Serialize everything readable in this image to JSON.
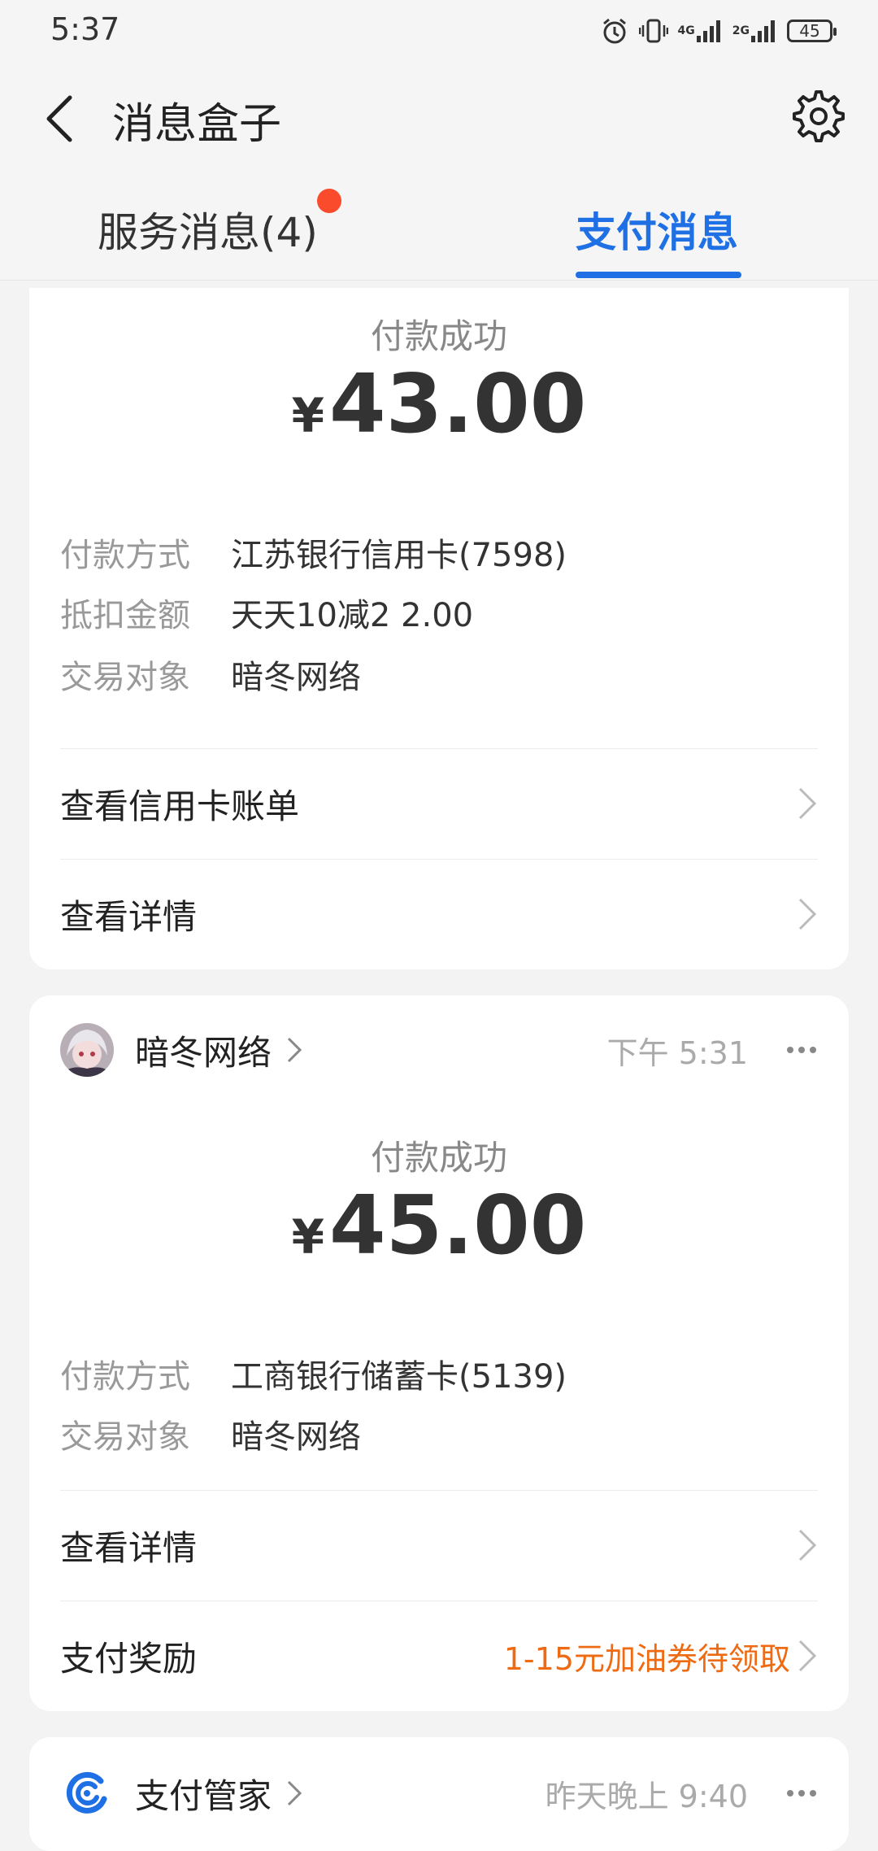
{
  "status_bar": {
    "time": "5:37",
    "network1": "4G",
    "network2": "2G",
    "battery": "45",
    "icons": [
      "alarm-icon",
      "vibrate-icon",
      "signal-icon",
      "signal-icon",
      "battery-icon"
    ]
  },
  "header": {
    "title": "消息盒子",
    "back_icon": "chevron-left-icon",
    "settings_icon": "gear-icon"
  },
  "tabs": [
    {
      "label": "服务消息(4)",
      "active": false,
      "has_dot": true
    },
    {
      "label": "支付消息",
      "active": true
    }
  ],
  "colors": {
    "accent": "#1f6fe5",
    "dot": "#fa4b2d",
    "promo": "#ee6a13"
  },
  "cards": [
    {
      "status": "付款成功",
      "currency": "¥",
      "amount": "43.00",
      "fields": [
        {
          "key": "付款方式",
          "value": "江苏银行信用卡(7598)"
        },
        {
          "key": "抵扣金额",
          "value": "天天10减2 2.00"
        },
        {
          "key": "交易对象",
          "value": "暗冬网络"
        }
      ],
      "actions": [
        {
          "label": "查看信用卡账单"
        },
        {
          "label": "查看详情"
        }
      ]
    },
    {
      "merchant": "暗冬网络",
      "time": "下午 5:31",
      "status": "付款成功",
      "currency": "¥",
      "amount": "45.00",
      "fields": [
        {
          "key": "付款方式",
          "value": "工商银行储蓄卡(5139)"
        },
        {
          "key": "交易对象",
          "value": "暗冬网络"
        }
      ],
      "actions": [
        {
          "label": "查看详情"
        },
        {
          "label": "支付奖励",
          "extra": "1-15元加油券待领取"
        }
      ]
    },
    {
      "merchant": "支付管家",
      "time": "昨天晚上 9:40"
    }
  ]
}
